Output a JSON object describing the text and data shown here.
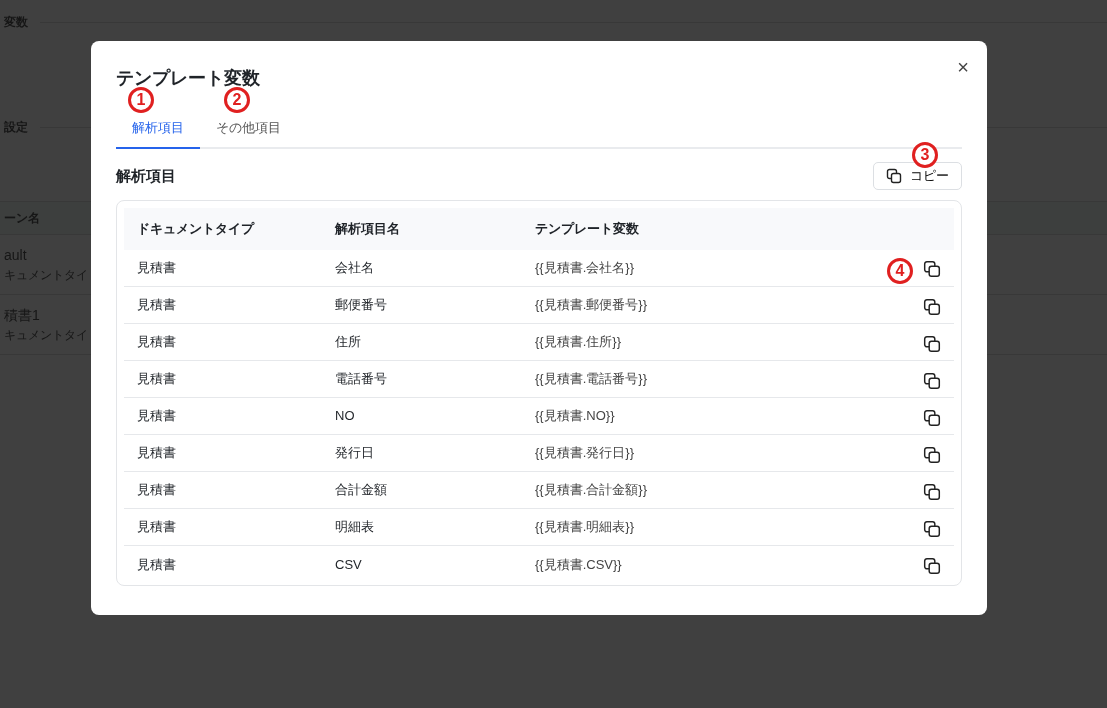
{
  "background_page": {
    "sections": [
      {
        "title": "変数"
      },
      {
        "title": "設定"
      }
    ],
    "table": {
      "column_1": "ーン名",
      "rows": [
        {
          "name": "ault",
          "type": "キュメントタイ"
        },
        {
          "name": "積書1",
          "type": "キュメントタイ"
        }
      ]
    }
  },
  "dialog": {
    "title": "テンプレート変数",
    "close": "×",
    "tabs": [
      {
        "label": "解析項目",
        "selected": true
      },
      {
        "label": "その他項目",
        "selected": false
      }
    ],
    "section_title": "解析項目",
    "copy_button": "コピー",
    "table": {
      "columns": [
        "ドキュメントタイプ",
        "解析項目名",
        "テンプレート変数"
      ],
      "rows": [
        {
          "document_type": "見積書",
          "item": "会社名",
          "variable": "{{見積書.会社名}}"
        },
        {
          "document_type": "見積書",
          "item": "郵便番号",
          "variable": "{{見積書.郵便番号}}"
        },
        {
          "document_type": "見積書",
          "item": "住所",
          "variable": "{{見積書.住所}}"
        },
        {
          "document_type": "見積書",
          "item": "電話番号",
          "variable": "{{見積書.電話番号}}"
        },
        {
          "document_type": "見積書",
          "item": "NO",
          "variable": "{{見積書.NO}}"
        },
        {
          "document_type": "見積書",
          "item": "発行日",
          "variable": "{{見積書.発行日}}"
        },
        {
          "document_type": "見積書",
          "item": "合計金額",
          "variable": "{{見積書.合計金額}}"
        },
        {
          "document_type": "見積書",
          "item": "明細表",
          "variable": "{{見積書.明細表}}"
        },
        {
          "document_type": "見積書",
          "item": "CSV",
          "variable": "{{見積書.CSV}}"
        }
      ]
    }
  },
  "annotations": [
    {
      "label": "1"
    },
    {
      "label": "2"
    },
    {
      "label": "3"
    },
    {
      "label": "4"
    }
  ]
}
